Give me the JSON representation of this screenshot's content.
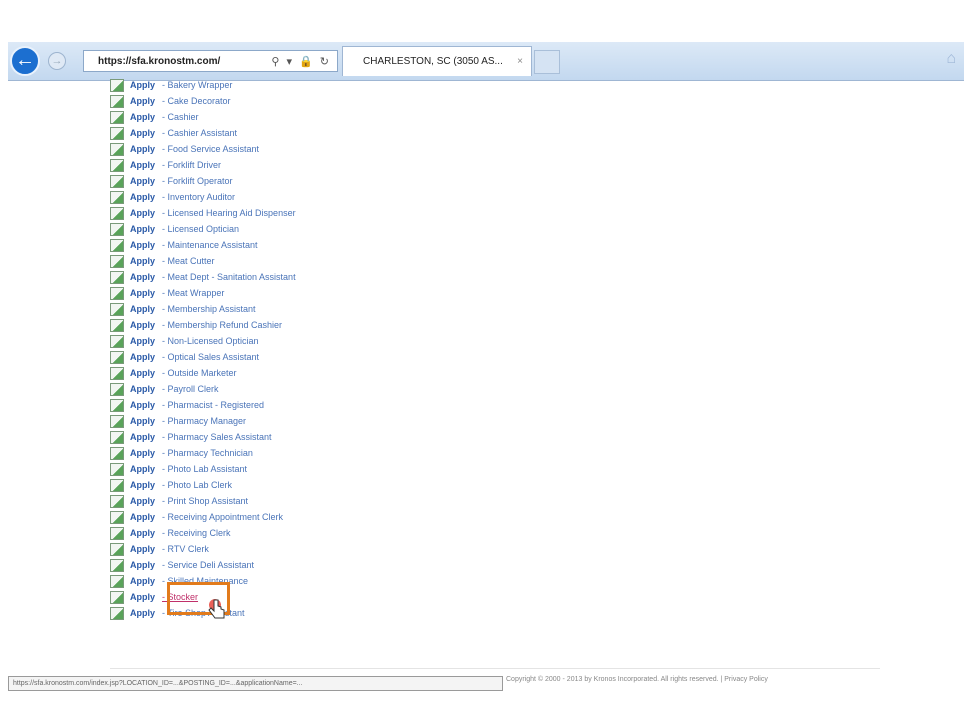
{
  "browser": {
    "address": "https://sfa.kronostm.com/",
    "address_host_hint": "kronostm.com",
    "tab_title": "CHARLESTON, SC (3050 AS...",
    "tab_close": "×"
  },
  "apply_label": "Apply",
  "jobs": [
    "- Bakery Wrapper",
    "- Cake Decorator",
    "- Cashier",
    "- Cashier Assistant",
    "- Food Service Assistant",
    "- Forklift Driver",
    "- Forklift Operator",
    "- Inventory Auditor",
    "- Licensed Hearing Aid Dispenser",
    "- Licensed Optician",
    "- Maintenance Assistant",
    "- Meat Cutter",
    "- Meat Dept - Sanitation Assistant",
    "- Meat Wrapper",
    "- Membership Assistant",
    "- Membership Refund Cashier",
    "- Non-Licensed Optician",
    "- Optical Sales Assistant",
    "- Outside Marketer",
    "- Payroll Clerk",
    "- Pharmacist - Registered",
    "- Pharmacy Manager",
    "- Pharmacy Sales Assistant",
    "- Pharmacy Technician",
    "- Photo Lab Assistant",
    "- Photo Lab Clerk",
    "- Print Shop Assistant",
    "- Receiving Appointment Clerk",
    "- Receiving Clerk",
    "- RTV Clerk",
    "- Service Deli Assistant",
    "- Skilled Maintenance",
    "- Stocker",
    "- Tire Shop Assistant"
  ],
  "status_url": "https://sfa.kronostm.com/index.jsp?LOCATION_ID=...&POSTING_ID=...&applicationName=...",
  "footer_text": "Copyright © 2000 - 2013 by Kronos Incorporated. All rights reserved. | Privacy Policy",
  "colors": {
    "accent": "#1c6fd0",
    "highlight_box": "#e27b1c"
  }
}
